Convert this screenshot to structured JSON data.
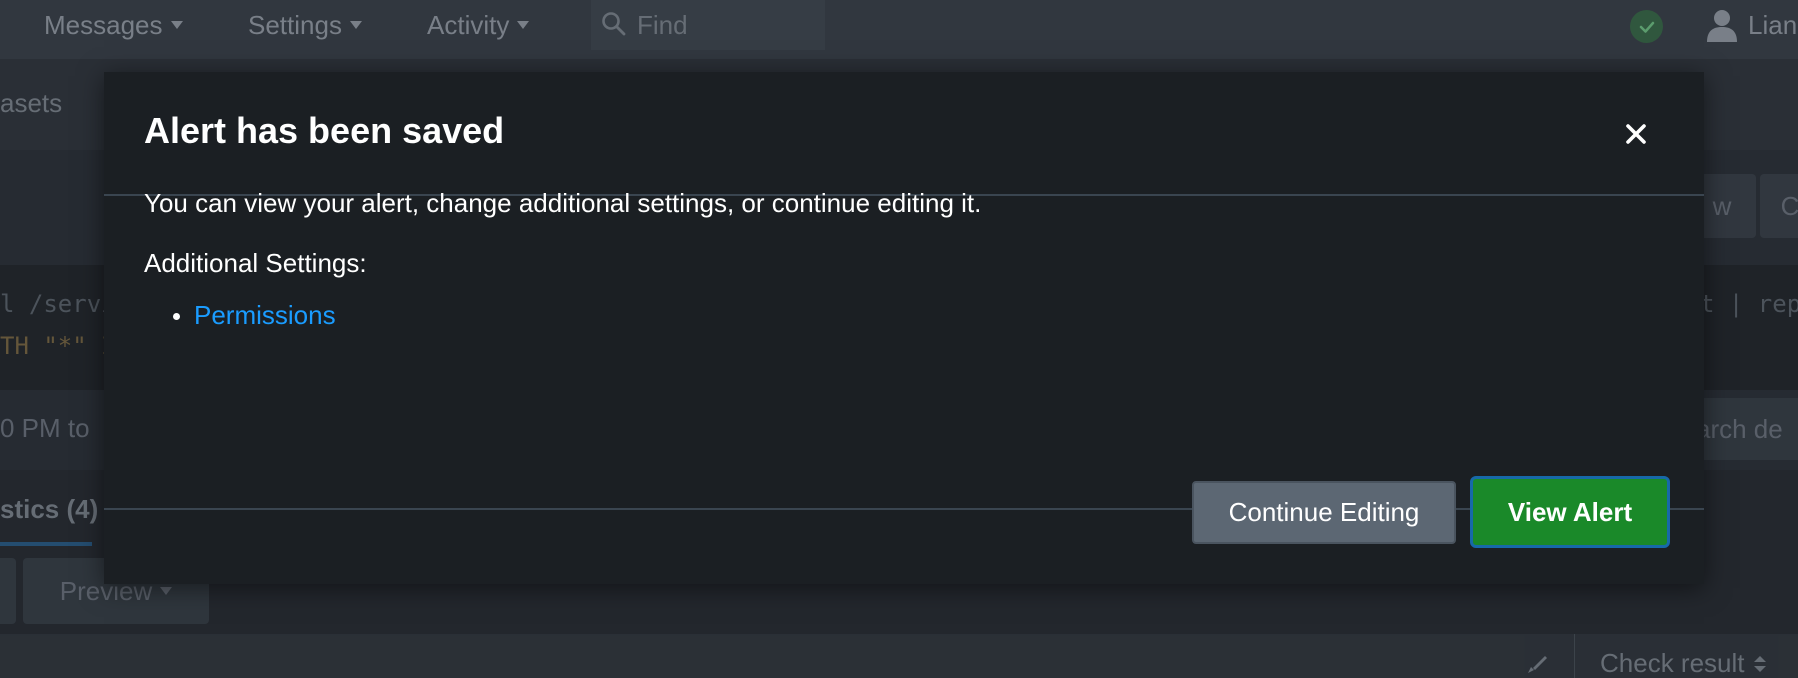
{
  "topnav": {
    "items": [
      {
        "label": "Messages"
      },
      {
        "label": "Settings"
      },
      {
        "label": "Activity"
      }
    ],
    "find_placeholder": "Find",
    "user_name": "Lian"
  },
  "background": {
    "datasets_tab": "asets",
    "btn_right_1": "w",
    "btn_right_2": "C",
    "search_line1": "l /servi",
    "search_line2": "TH \"*\" I",
    "search_right": "t | rep",
    "time_text": "0 PM to",
    "search_details": "arch de",
    "statistics_tab": "stics (4)",
    "preview_label": "Preview",
    "check_result_label": "Check result"
  },
  "modal": {
    "title": "Alert has been saved",
    "body_text": "You can view your alert, change additional settings, or continue editing it.",
    "settings_label": "Additional Settings:",
    "settings_links": [
      {
        "label": "Permissions"
      }
    ],
    "continue_button": "Continue Editing",
    "view_button": "View Alert"
  },
  "colors": {
    "primary_button": "#1a8929",
    "link": "#1a9cff",
    "modal_bg": "#1b1f23"
  }
}
